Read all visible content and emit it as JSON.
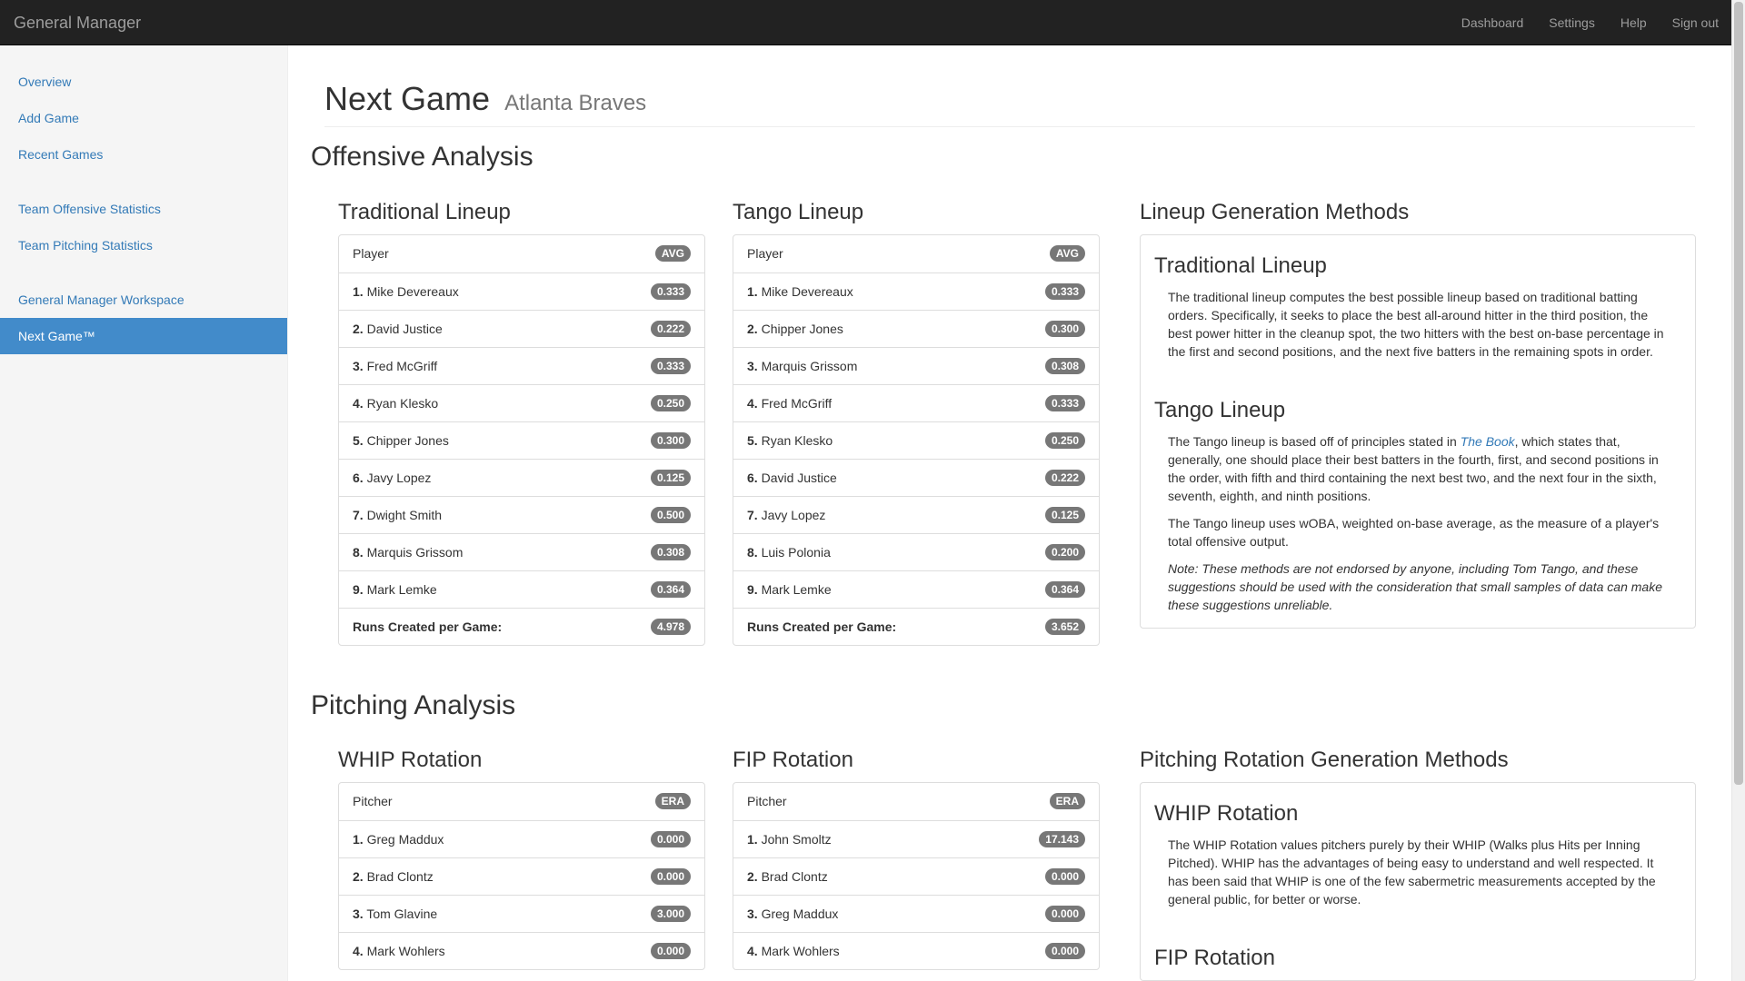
{
  "navbar": {
    "brand": "General Manager",
    "links": [
      "Dashboard",
      "Settings",
      "Help",
      "Sign out"
    ]
  },
  "sidebar": {
    "groups": [
      [
        "Overview",
        "Add Game",
        "Recent Games"
      ],
      [
        "Team Offensive Statistics",
        "Team Pitching Statistics"
      ],
      [
        "General Manager Workspace",
        "Next Game™"
      ]
    ],
    "active": "Next Game™"
  },
  "header": {
    "title": "Next Game",
    "subtitle": "Atlanta Braves"
  },
  "offense": {
    "title": "Offensive Analysis",
    "traditional": {
      "title": "Traditional Lineup",
      "col_player": "Player",
      "col_stat": "AVG",
      "rows": [
        {
          "n": "1.",
          "name": "Mike Devereaux",
          "val": "0.333"
        },
        {
          "n": "2.",
          "name": "David Justice",
          "val": "0.222"
        },
        {
          "n": "3.",
          "name": "Fred McGriff",
          "val": "0.333"
        },
        {
          "n": "4.",
          "name": "Ryan Klesko",
          "val": "0.250"
        },
        {
          "n": "5.",
          "name": "Chipper Jones",
          "val": "0.300"
        },
        {
          "n": "6.",
          "name": "Javy Lopez",
          "val": "0.125"
        },
        {
          "n": "7.",
          "name": "Dwight Smith",
          "val": "0.500"
        },
        {
          "n": "8.",
          "name": "Marquis Grissom",
          "val": "0.308"
        },
        {
          "n": "9.",
          "name": "Mark Lemke",
          "val": "0.364"
        }
      ],
      "total_label": "Runs Created per Game:",
      "total_val": "4.978"
    },
    "tango": {
      "title": "Tango Lineup",
      "col_player": "Player",
      "col_stat": "AVG",
      "rows": [
        {
          "n": "1.",
          "name": "Mike Devereaux",
          "val": "0.333"
        },
        {
          "n": "2.",
          "name": "Chipper Jones",
          "val": "0.300"
        },
        {
          "n": "3.",
          "name": "Marquis Grissom",
          "val": "0.308"
        },
        {
          "n": "4.",
          "name": "Fred McGriff",
          "val": "0.333"
        },
        {
          "n": "5.",
          "name": "Ryan Klesko",
          "val": "0.250"
        },
        {
          "n": "6.",
          "name": "David Justice",
          "val": "0.222"
        },
        {
          "n": "7.",
          "name": "Javy Lopez",
          "val": "0.125"
        },
        {
          "n": "8.",
          "name": "Luis Polonia",
          "val": "0.200"
        },
        {
          "n": "9.",
          "name": "Mark Lemke",
          "val": "0.364"
        }
      ],
      "total_label": "Runs Created per Game:",
      "total_val": "3.652"
    },
    "methods": {
      "title": "Lineup Generation Methods",
      "trad_title": "Traditional Lineup",
      "trad_text": "The traditional lineup computes the best possible lineup based on traditional batting orders. Specifically, it seeks to place the best all-around hitter in the third position, the best power hitter in the cleanup spot, the two hitters with the best on-base percentage in the first and second positions, and the next five batters in the remaining spots in order.",
      "tango_title": "Tango Lineup",
      "tango_text_pre": "The Tango lineup is based off of principles stated in ",
      "tango_link": "The Book",
      "tango_text_post": ", which states that, generally, one should place their best batters in the fourth, first, and second positions in the order, with fifth and third containing the next best two, and the next four in the sixth, seventh, eighth, and ninth positions.",
      "tango_text2": "The Tango lineup uses wOBA, weighted on-base average, as the measure of a player's total offensive output.",
      "note": "Note: These methods are not endorsed by anyone, including Tom Tango, and these suggestions should be used with the consideration that small samples of data can make these suggestions unreliable."
    }
  },
  "pitching": {
    "title": "Pitching Analysis",
    "whip": {
      "title": "WHIP Rotation",
      "col_player": "Pitcher",
      "col_stat": "ERA",
      "rows": [
        {
          "n": "1.",
          "name": "Greg Maddux",
          "val": "0.000"
        },
        {
          "n": "2.",
          "name": "Brad Clontz",
          "val": "0.000"
        },
        {
          "n": "3.",
          "name": "Tom Glavine",
          "val": "3.000"
        },
        {
          "n": "4.",
          "name": "Mark Wohlers",
          "val": "0.000"
        }
      ]
    },
    "fip": {
      "title": "FIP Rotation",
      "col_player": "Pitcher",
      "col_stat": "ERA",
      "rows": [
        {
          "n": "1.",
          "name": "John Smoltz",
          "val": "17.143"
        },
        {
          "n": "2.",
          "name": "Brad Clontz",
          "val": "0.000"
        },
        {
          "n": "3.",
          "name": "Greg Maddux",
          "val": "0.000"
        },
        {
          "n": "4.",
          "name": "Mark Wohlers",
          "val": "0.000"
        }
      ]
    },
    "methods": {
      "title": "Pitching Rotation Generation Methods",
      "whip_title": "WHIP Rotation",
      "whip_text": "The WHIP Rotation values pitchers purely by their WHIP (Walks plus Hits per Inning Pitched). WHIP has the advantages of being easy to understand and well respected. It has been said that WHIP is one of the few sabermetric measurements accepted by the general public, for better or worse.",
      "fip_title": "FIP Rotation"
    }
  }
}
